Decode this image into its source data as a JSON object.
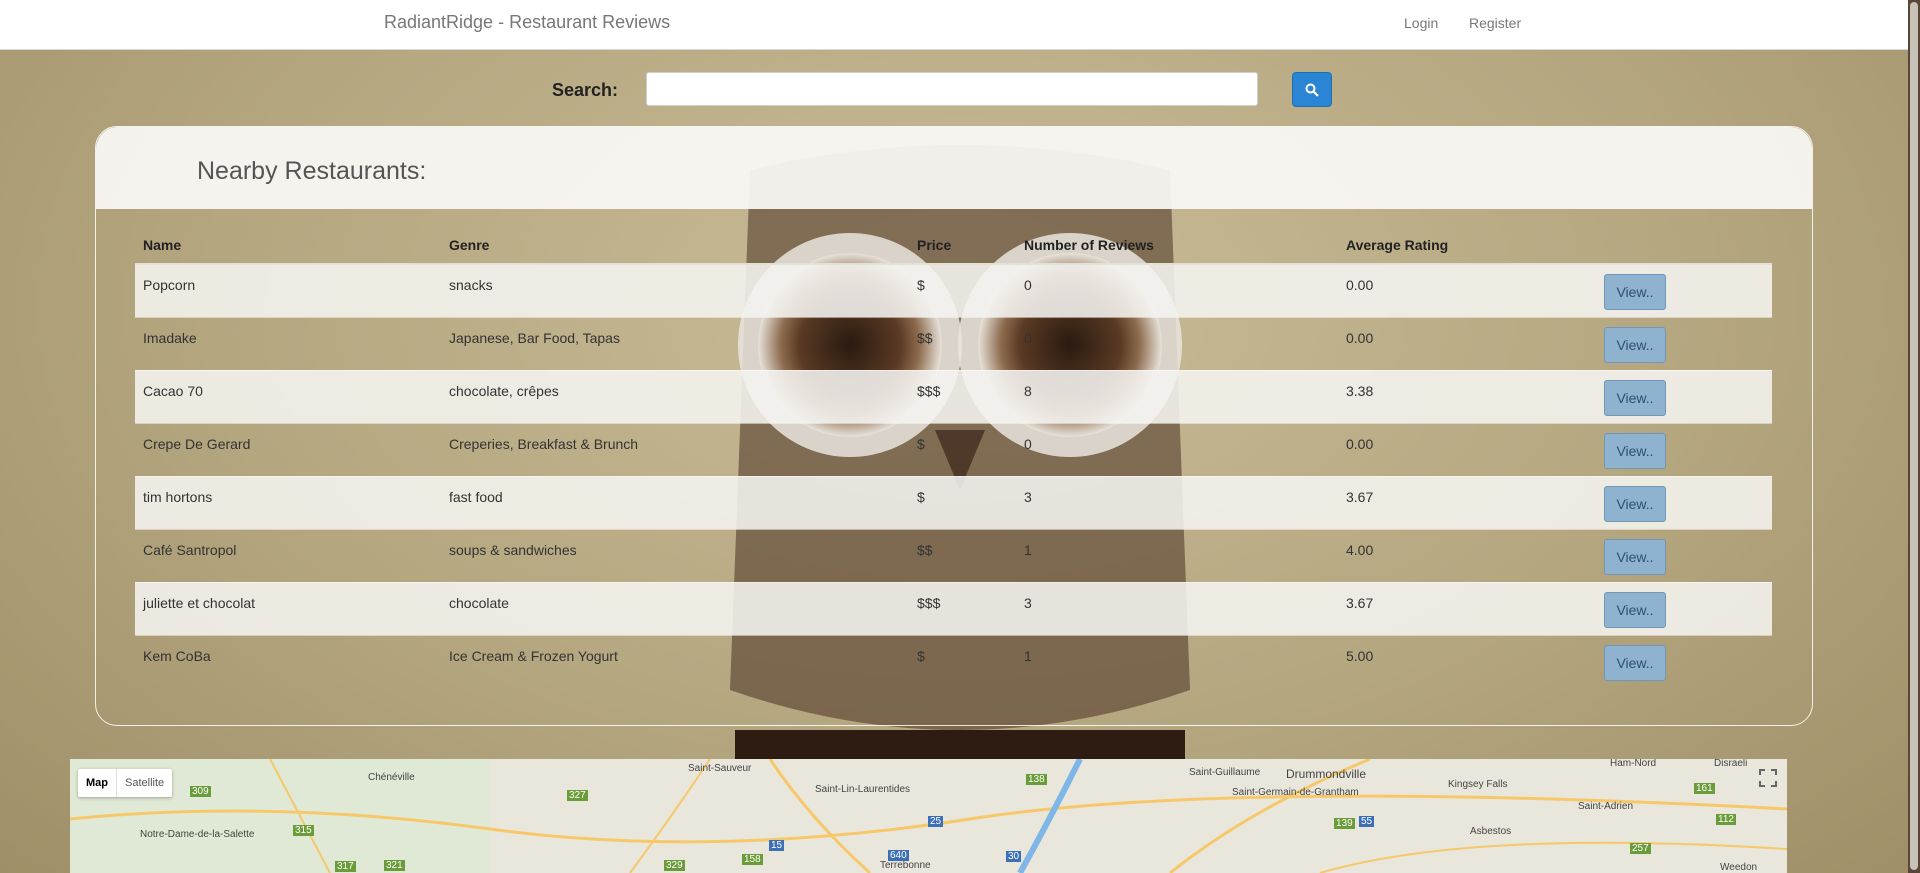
{
  "navbar": {
    "brand": "RadiantRidge - Restaurant Reviews",
    "login": "Login",
    "register": "Register"
  },
  "search": {
    "label": "Search:",
    "value": "",
    "icon": "search-icon"
  },
  "panel": {
    "title": "Nearby Restaurants:"
  },
  "table": {
    "columns": [
      "Name",
      "Genre",
      "Price",
      "Number of Reviews",
      "Average Rating"
    ],
    "rows": [
      {
        "name": "Popcorn",
        "genre": "snacks",
        "price": "$",
        "reviews": "0",
        "rating": "0.00",
        "action": "View.."
      },
      {
        "name": "Imadake",
        "genre": "Japanese, Bar Food, Tapas",
        "price": "$$",
        "reviews": "0",
        "rating": "0.00",
        "action": "View.."
      },
      {
        "name": "Cacao 70",
        "genre": "chocolate, crêpes",
        "price": "$$$",
        "reviews": "8",
        "rating": "3.38",
        "action": "View.."
      },
      {
        "name": "Crepe De Gerard",
        "genre": "Creperies, Breakfast & Brunch",
        "price": "$",
        "reviews": "0",
        "rating": "0.00",
        "action": "View.."
      },
      {
        "name": "tim hortons",
        "genre": "fast food",
        "price": "$",
        "reviews": "3",
        "rating": "3.67",
        "action": "View.."
      },
      {
        "name": "Café Santropol",
        "genre": "soups & sandwiches",
        "price": "$$",
        "reviews": "1",
        "rating": "4.00",
        "action": "View.."
      },
      {
        "name": "juliette et chocolat",
        "genre": "chocolate",
        "price": "$$$",
        "reviews": "3",
        "rating": "3.67",
        "action": "View.."
      },
      {
        "name": "Kem CoBa",
        "genre": "Ice Cream & Frozen Yogurt",
        "price": "$",
        "reviews": "1",
        "rating": "5.00",
        "action": "View.."
      }
    ]
  },
  "map": {
    "map_label": "Map",
    "satellite_label": "Satellite",
    "places": [
      "Chénéville",
      "Saint-Sauveur",
      "Saint-Lin-Laurentides",
      "Notre-Dame-de-la-Salette",
      "Saint-Guillaume",
      "Drummondville",
      "Saint-Germain-de-Grantham",
      "Kingsey Falls",
      "Ham-Nord",
      "Disraeli",
      "Saint-Adrien",
      "Asbestos",
      "Terrebonne",
      "Weedon"
    ],
    "route_numbers": [
      "309",
      "327",
      "315",
      "317",
      "321",
      "329",
      "158",
      "15",
      "640",
      "25",
      "30",
      "138",
      "139",
      "55",
      "161",
      "112",
      "257"
    ]
  },
  "colors": {
    "background": "#b3a47f",
    "search_button": "#2a86d4",
    "view_button": "#8fb2cf"
  }
}
